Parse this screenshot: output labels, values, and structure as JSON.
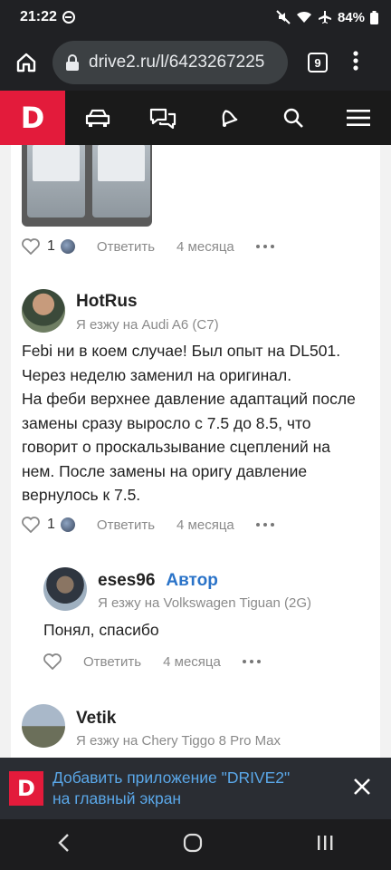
{
  "status_bar": {
    "time": "21:22",
    "battery": "84%"
  },
  "browser": {
    "url": "drive2.ru/l/6423267225",
    "tab_count": "9"
  },
  "photo_comment_actions": {
    "likes": "1",
    "reply": "Ответить",
    "ago": "4 месяца"
  },
  "comments": [
    {
      "username": "HotRus",
      "car": "Я езжу на Audi A6 (C7)",
      "text_lines": [
        "Febi ни в коем случае! Был опыт на DL501.",
        "Через неделю заменил на оригинал.",
        "На феби верхнее давление адаптаций после",
        "замены сразу выросло с 7.5 до 8.5, что",
        "говорит о проскальзывание сцеплений на",
        "нем. После замены на оригу давление",
        "вернулось к 7.5."
      ],
      "likes": "1",
      "reply": "Ответить",
      "ago": "4 месяца"
    },
    {
      "username": "eses96",
      "author_badge": "Автор",
      "car": "Я езжу на Volkswagen Tiguan (2G)",
      "text": "Понял, спасибо",
      "reply": "Ответить",
      "ago": "4 месяца"
    },
    {
      "username": "Vetik",
      "car": "Я езжу на Chery Tiggo 8 Pro Max"
    }
  ],
  "banner": {
    "logo": "D",
    "text_line1": "Добавить приложение \"DRIVE2\"",
    "text_line2": "на главный экран"
  },
  "site_nav": {
    "logo": "D"
  },
  "colors": {
    "brand": "#e31b3b",
    "link": "#2a73c8"
  }
}
